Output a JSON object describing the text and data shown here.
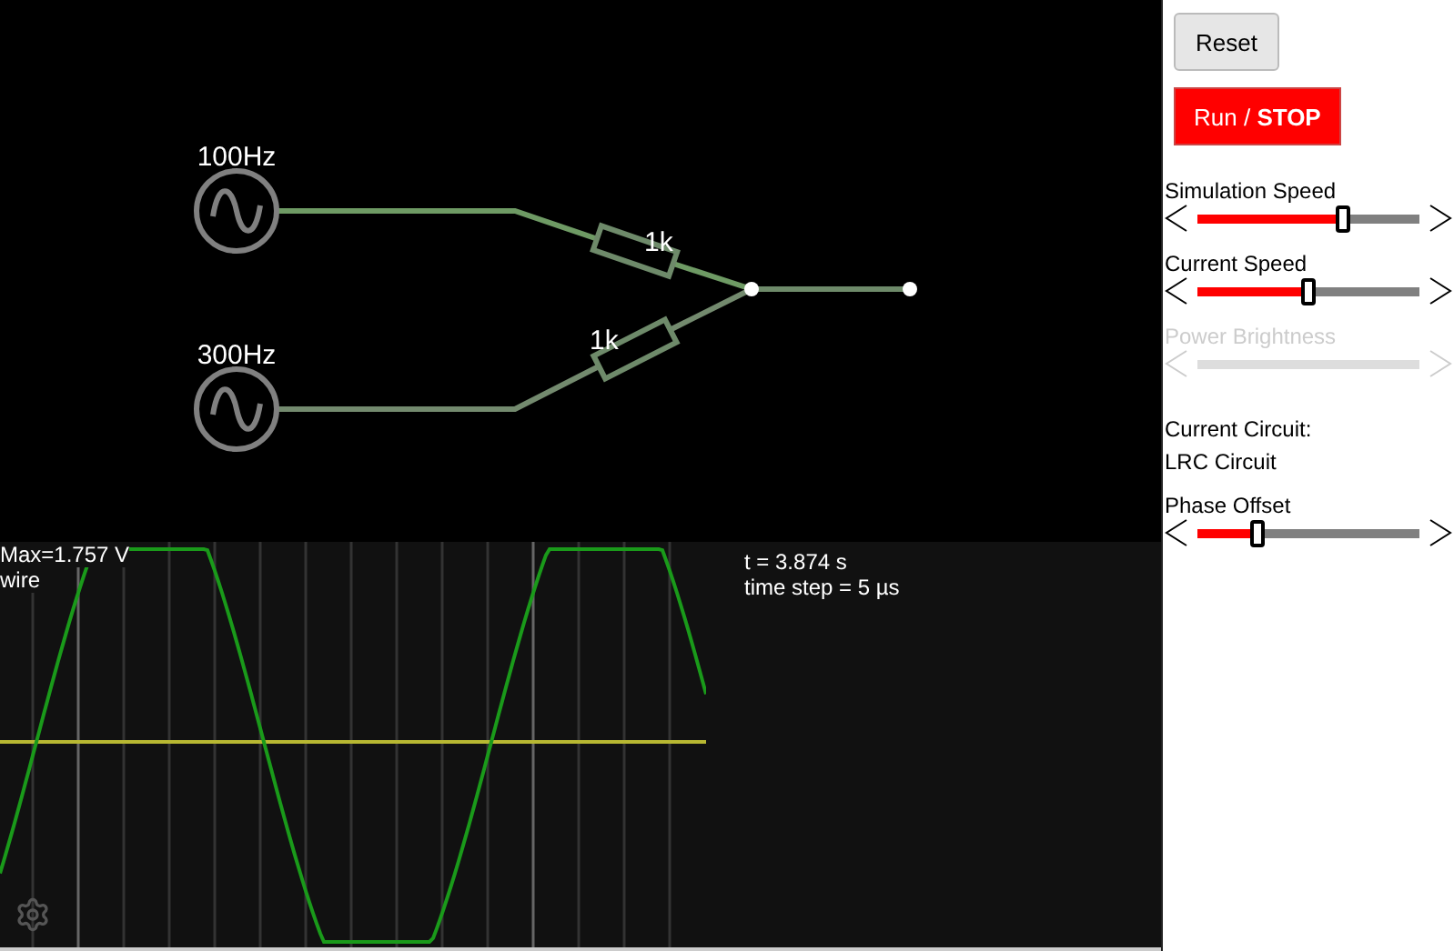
{
  "circuit": {
    "sources": [
      {
        "label": "100Hz"
      },
      {
        "label": "300Hz"
      }
    ],
    "resistors": [
      {
        "label": "1k"
      },
      {
        "label": "1k"
      }
    ]
  },
  "scope": {
    "max_label": "Max=1.757 V",
    "probe_label": "wire",
    "time": "t = 3.874 s",
    "time_step": "time step = 5 µs"
  },
  "panel": [
    {
      "kind": "button",
      "label": "Reset"
    },
    {
      "kind": "run",
      "label": "Run / **STOP**"
    },
    {
      "kind": "slider",
      "label": "Simulation Speed",
      "level": 0.66,
      "disabled": false
    },
    {
      "kind": "slider",
      "label": "Current Speed",
      "level": 0.5,
      "disabled": false
    },
    {
      "kind": "slider",
      "label": "Power Brightness",
      "disabled": true
    },
    {
      "kind": "text",
      "lines": [
        "Current Circuit:",
        "LRC Circuit"
      ]
    },
    {
      "kind": "slider",
      "label": "Phase Offset",
      "level": 0.26,
      "disabled": false
    }
  ]
}
